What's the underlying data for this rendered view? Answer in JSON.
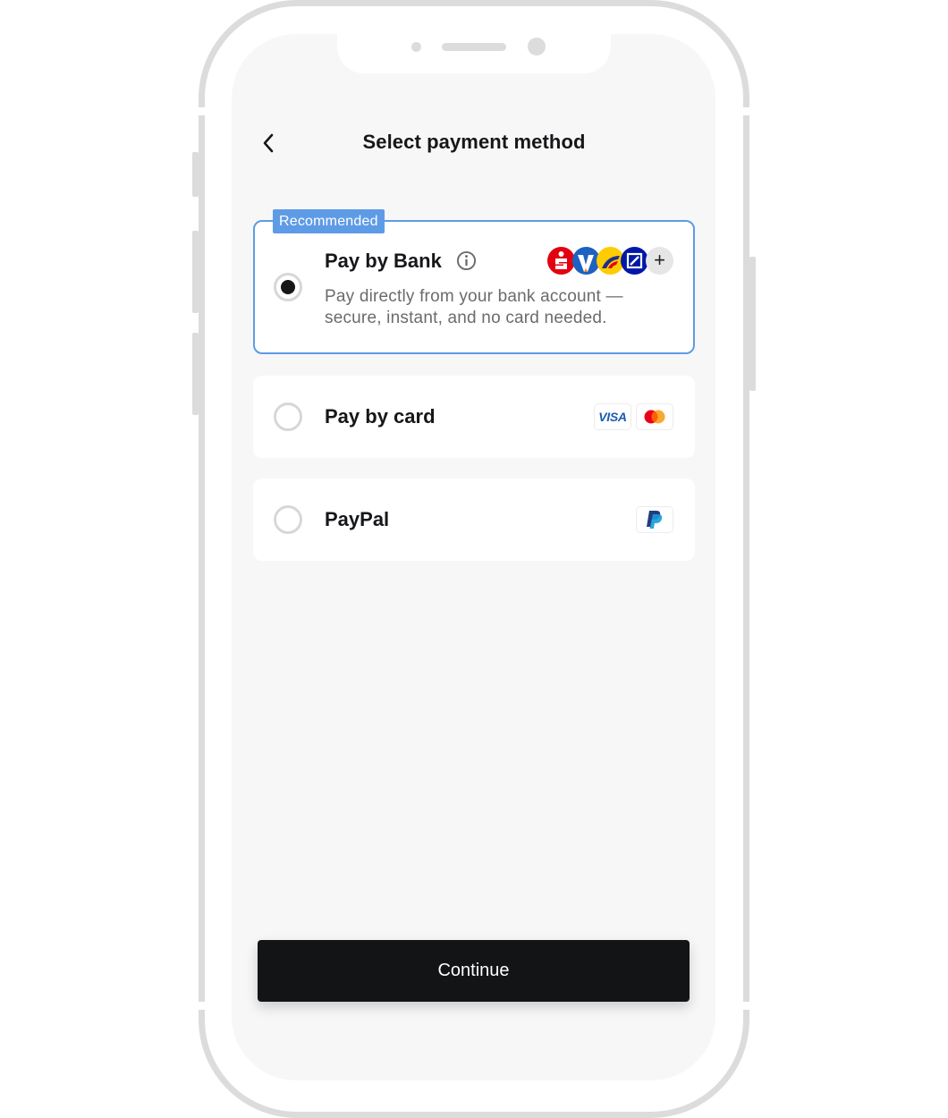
{
  "header": {
    "title": "Select payment method",
    "back_icon": "chevron-left-icon"
  },
  "options": [
    {
      "id": "pay-by-bank",
      "title": "Pay by Bank",
      "badge": "Recommended",
      "selected": true,
      "description": "Pay directly from your bank account — secure, instant, and no card needed.",
      "info_icon": "info-icon",
      "logos": [
        "sparkasse-logo",
        "volksbank-logo",
        "postbank-logo",
        "deutsche-bank-logo",
        "more-banks-icon"
      ],
      "more_label": "+"
    },
    {
      "id": "pay-by-card",
      "title": "Pay by card",
      "selected": false,
      "logos": [
        "visa-logo",
        "mastercard-logo"
      ],
      "visa_label": "VISA"
    },
    {
      "id": "paypal",
      "title": "PayPal",
      "selected": false,
      "logos": [
        "paypal-logo"
      ]
    }
  ],
  "footer": {
    "continue_label": "Continue"
  },
  "colors": {
    "accent": "#5e9be6",
    "primary_button": "#131416",
    "screen_background": "#f7f7f7",
    "frame": "#dcdcdc"
  }
}
